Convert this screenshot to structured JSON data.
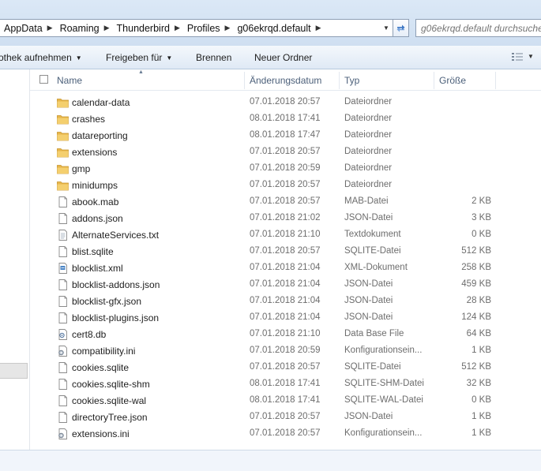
{
  "address": {
    "crumbs": [
      "AppData",
      "Roaming",
      "Thunderbird",
      "Profiles",
      "g06ekrqd.default"
    ],
    "search_placeholder": "g06ekrqd.default durchsuchen"
  },
  "toolbar": {
    "library_label": "othek aufnehmen",
    "share_label": "Freigeben für",
    "burn_label": "Brennen",
    "new_folder_label": "Neuer Ordner"
  },
  "columns": {
    "name": "Name",
    "date": "Änderungsdatum",
    "type": "Typ",
    "size": "Größe"
  },
  "files": [
    {
      "name": "calendar-data",
      "date": "07.01.2018 20:57",
      "type": "Dateiordner",
      "size": "",
      "icon": "folder-icon"
    },
    {
      "name": "crashes",
      "date": "08.01.2018 17:41",
      "type": "Dateiordner",
      "size": "",
      "icon": "folder-icon"
    },
    {
      "name": "datareporting",
      "date": "08.01.2018 17:47",
      "type": "Dateiordner",
      "size": "",
      "icon": "folder-icon"
    },
    {
      "name": "extensions",
      "date": "07.01.2018 20:57",
      "type": "Dateiordner",
      "size": "",
      "icon": "folder-icon"
    },
    {
      "name": "gmp",
      "date": "07.01.2018 20:59",
      "type": "Dateiordner",
      "size": "",
      "icon": "folder-icon"
    },
    {
      "name": "minidumps",
      "date": "07.01.2018 20:57",
      "type": "Dateiordner",
      "size": "",
      "icon": "folder-icon"
    },
    {
      "name": "abook.mab",
      "date": "07.01.2018 20:57",
      "type": "MAB-Datei",
      "size": "2 KB",
      "icon": "file-icon"
    },
    {
      "name": "addons.json",
      "date": "07.01.2018 21:02",
      "type": "JSON-Datei",
      "size": "3 KB",
      "icon": "file-icon"
    },
    {
      "name": "AlternateServices.txt",
      "date": "07.01.2018 21:10",
      "type": "Textdokument",
      "size": "0 KB",
      "icon": "text-file-icon"
    },
    {
      "name": "blist.sqlite",
      "date": "07.01.2018 20:57",
      "type": "SQLITE-Datei",
      "size": "512 KB",
      "icon": "file-icon"
    },
    {
      "name": "blocklist.xml",
      "date": "07.01.2018 21:04",
      "type": "XML-Dokument",
      "size": "258 KB",
      "icon": "xml-file-icon"
    },
    {
      "name": "blocklist-addons.json",
      "date": "07.01.2018 21:04",
      "type": "JSON-Datei",
      "size": "459 KB",
      "icon": "file-icon"
    },
    {
      "name": "blocklist-gfx.json",
      "date": "07.01.2018 21:04",
      "type": "JSON-Datei",
      "size": "28 KB",
      "icon": "file-icon"
    },
    {
      "name": "blocklist-plugins.json",
      "date": "07.01.2018 21:04",
      "type": "JSON-Datei",
      "size": "124 KB",
      "icon": "file-icon"
    },
    {
      "name": "cert8.db",
      "date": "07.01.2018 21:10",
      "type": "Data Base File",
      "size": "64 KB",
      "icon": "db-file-icon"
    },
    {
      "name": "compatibility.ini",
      "date": "07.01.2018 20:59",
      "type": "Konfigurationsein...",
      "size": "1 KB",
      "icon": "ini-file-icon"
    },
    {
      "name": "cookies.sqlite",
      "date": "07.01.2018 20:57",
      "type": "SQLITE-Datei",
      "size": "512 KB",
      "icon": "file-icon"
    },
    {
      "name": "cookies.sqlite-shm",
      "date": "08.01.2018 17:41",
      "type": "SQLITE-SHM-Datei",
      "size": "32 KB",
      "icon": "file-icon"
    },
    {
      "name": "cookies.sqlite-wal",
      "date": "08.01.2018 17:41",
      "type": "SQLITE-WAL-Datei",
      "size": "0 KB",
      "icon": "file-icon"
    },
    {
      "name": "directoryTree.json",
      "date": "07.01.2018 20:57",
      "type": "JSON-Datei",
      "size": "1 KB",
      "icon": "file-icon"
    },
    {
      "name": "extensions.ini",
      "date": "07.01.2018 20:57",
      "type": "Konfigurationsein...",
      "size": "1 KB",
      "icon": "ini-file-icon"
    }
  ]
}
